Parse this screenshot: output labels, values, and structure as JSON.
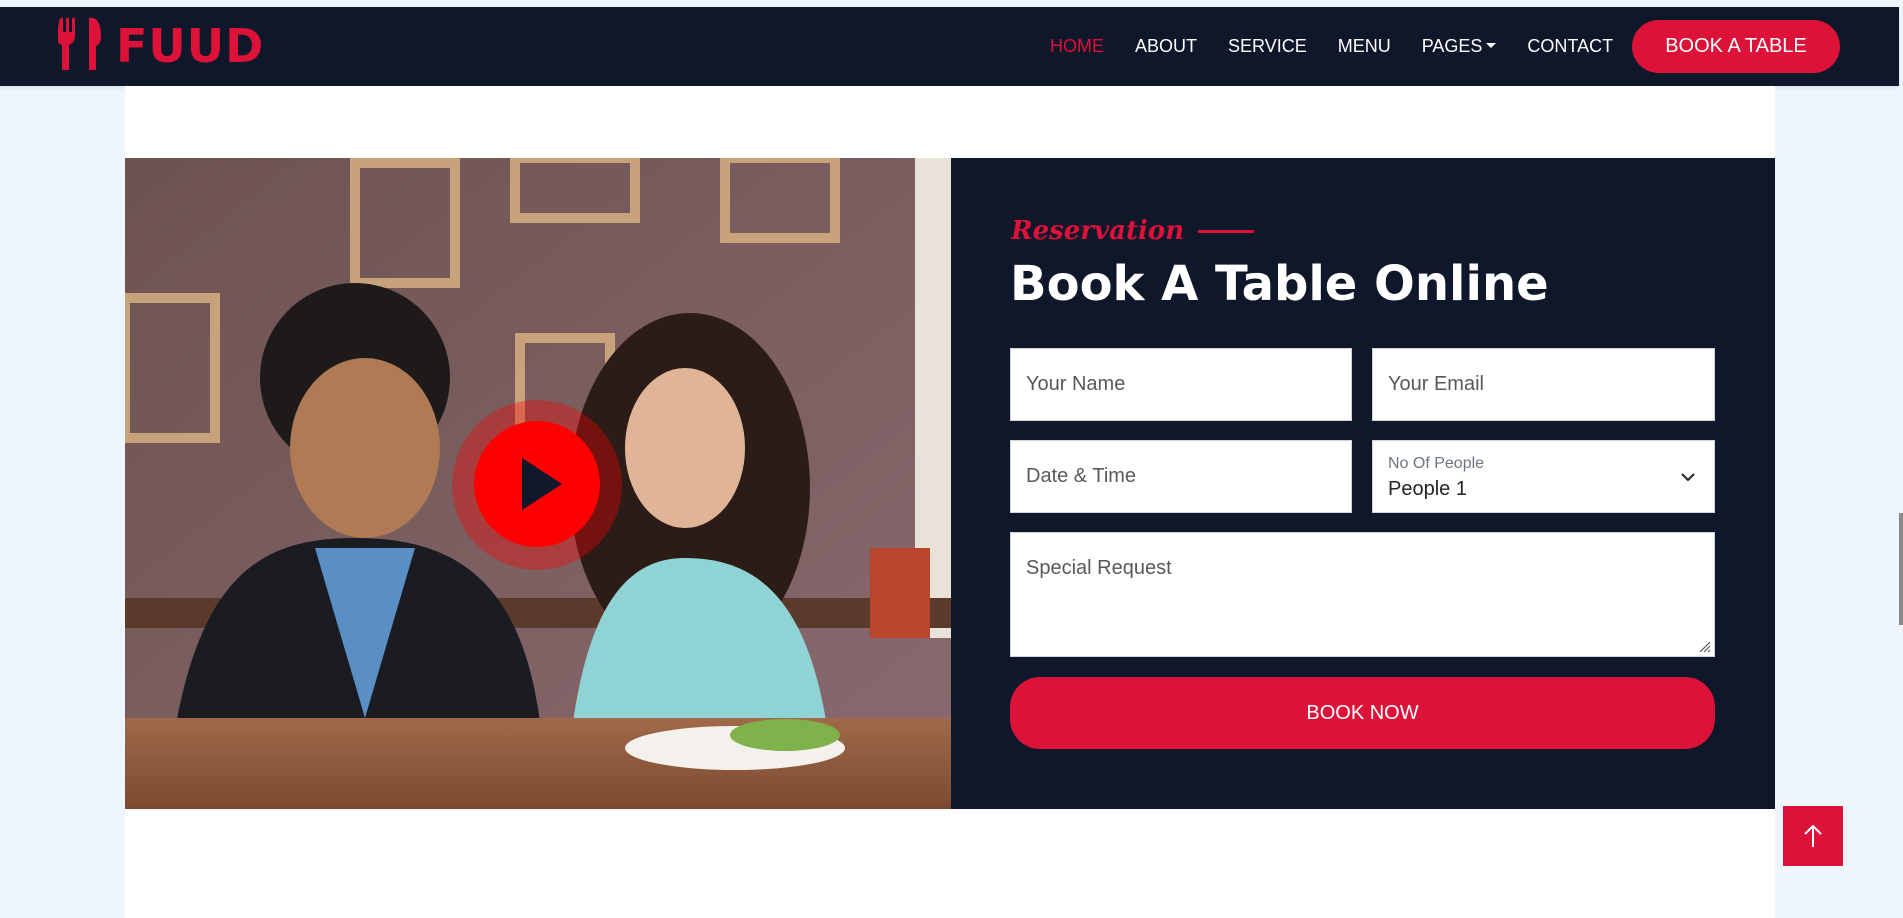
{
  "brand": {
    "name": "FUUD",
    "icon": "utensils-icon",
    "color": "#dc1239"
  },
  "nav": {
    "items": [
      {
        "label": "HOME",
        "active": true
      },
      {
        "label": "ABOUT"
      },
      {
        "label": "SERVICE"
      },
      {
        "label": "MENU"
      },
      {
        "label": "PAGES",
        "dropdown": true
      },
      {
        "label": "CONTACT"
      }
    ],
    "cta_label": "BOOK A TABLE"
  },
  "video": {
    "play_icon": "play-icon"
  },
  "reservation": {
    "subtitle": "Reservation",
    "title": "Book A Table Online",
    "fields": {
      "name_placeholder": "Your Name",
      "email_placeholder": "Your Email",
      "datetime_placeholder": "Date & Time",
      "people_label": "No Of People",
      "people_value": "People 1",
      "request_placeholder": "Special Request"
    },
    "submit_label": "BOOK NOW"
  },
  "back_to_top": {
    "icon": "arrow-up-icon"
  },
  "colors": {
    "primary": "#dc1239",
    "dark": "#0f172b",
    "background": "#eef5fd"
  }
}
